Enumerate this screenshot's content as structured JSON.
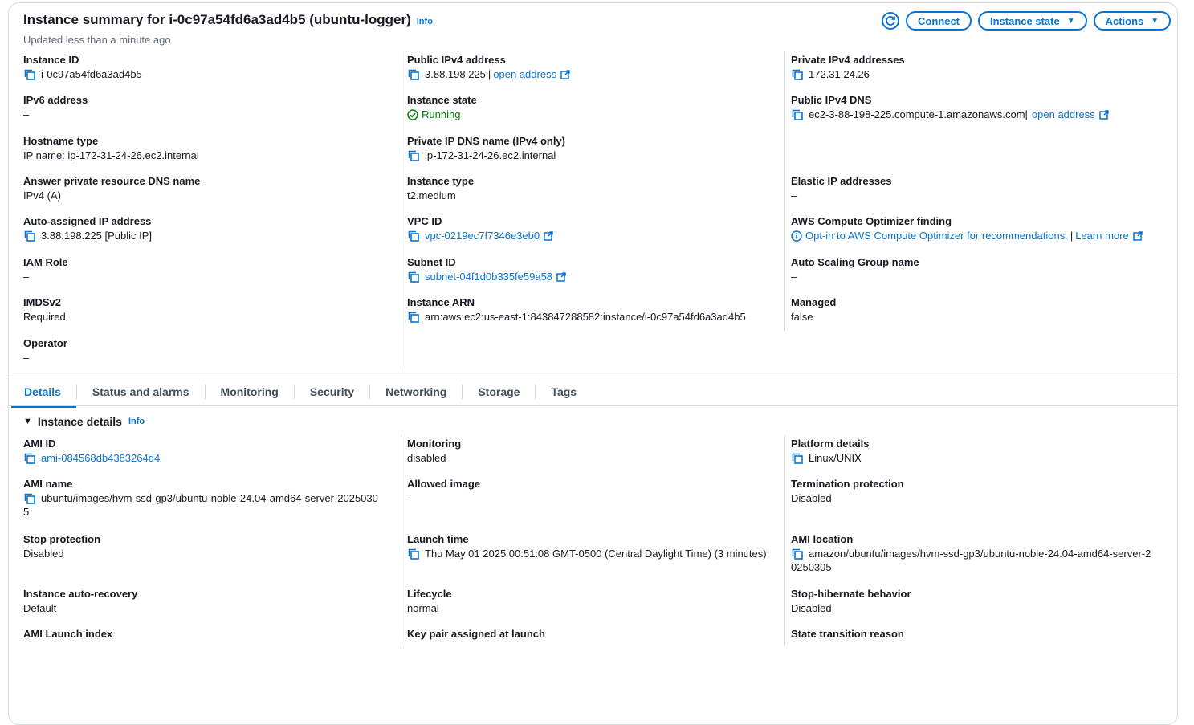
{
  "summary": {
    "title": "Instance summary for i-0c97a54fd6a3ad4b5 (ubuntu-logger)",
    "info": "Info",
    "updated": "Updated less than a minute ago",
    "buttons": {
      "connect": "Connect",
      "instance_state": "Instance state",
      "actions": "Actions"
    },
    "col1": [
      {
        "label": "Instance ID",
        "value": "i-0c97a54fd6a3ad4b5"
      },
      {
        "label": "IPv6 address",
        "value": "–"
      },
      {
        "label": "Hostname type",
        "value": "IP name: ip-172-31-24-26.ec2.internal"
      },
      {
        "label": "Answer private resource DNS name",
        "value": "IPv4 (A)"
      },
      {
        "label": "Auto-assigned IP address",
        "value": "3.88.198.225 [Public IP]"
      },
      {
        "label": "IAM Role",
        "value": "–"
      },
      {
        "label": "IMDSv2",
        "value": "Required"
      },
      {
        "label": "Operator",
        "value": "–"
      }
    ],
    "col2": [
      {
        "label": "Public IPv4 address",
        "value": "3.88.198.225",
        "link": "open address"
      },
      {
        "label": "Instance state",
        "value": "Running"
      },
      {
        "label": "Private IP DNS name (IPv4 only)",
        "value": "ip-172-31-24-26.ec2.internal"
      },
      {
        "label": "Instance type",
        "value": "t2.medium"
      },
      {
        "label": "VPC ID",
        "value": "vpc-0219ec7f7346e3eb0"
      },
      {
        "label": "Subnet ID",
        "value": "subnet-04f1d0b335fe59a58"
      },
      {
        "label": "Instance ARN",
        "value": "arn:aws:ec2:us-east-1:843847288582:instance/i-0c97a54fd6a3ad4b5"
      }
    ],
    "col3": [
      {
        "label": "Private IPv4 addresses",
        "value": "172.31.24.26"
      },
      {
        "label": "Public IPv4 DNS",
        "value": "ec2-3-88-198-225.compute-1.amazonaws.com",
        "link": "open address"
      },
      {
        "label": "Elastic IP addresses",
        "value": "–"
      },
      {
        "label": "AWS Compute Optimizer finding",
        "value": "Opt-in to AWS Compute Optimizer for recommendations.",
        "link": "Learn more"
      },
      {
        "label": "Auto Scaling Group name",
        "value": "–"
      },
      {
        "label": "Managed",
        "value": "false"
      }
    ]
  },
  "tabs": [
    "Details",
    "Status and alarms",
    "Monitoring",
    "Security",
    "Networking",
    "Storage",
    "Tags"
  ],
  "details": {
    "heading": "Instance details",
    "info": "Info",
    "col1": [
      {
        "label": "AMI ID",
        "value": "ami-084568db4383264d4"
      },
      {
        "label": "AMI name",
        "value_line1": "ubuntu/images/hvm-ssd-gp3/ubuntu-noble-24.04-amd64-server-2025030",
        "value_line2": "5"
      },
      {
        "label": "Stop protection",
        "value": "Disabled"
      },
      {
        "label": "Instance auto-recovery",
        "value": "Default"
      },
      {
        "label": "AMI Launch index",
        "value": ""
      }
    ],
    "col2": [
      {
        "label": "Monitoring",
        "value": "disabled"
      },
      {
        "label": "Allowed image",
        "value": "-"
      },
      {
        "label": "Launch time",
        "value": "Thu May 01 2025 00:51:08 GMT-0500 (Central Daylight Time) (3 minutes)"
      },
      {
        "label": "Lifecycle",
        "value": "normal"
      },
      {
        "label": "Key pair assigned at launch",
        "value": ""
      }
    ],
    "col3": [
      {
        "label": "Platform details",
        "value": "Linux/UNIX"
      },
      {
        "label": "Termination protection",
        "value": "Disabled"
      },
      {
        "label": "AMI location",
        "value_line1": "amazon/ubuntu/images/hvm-ssd-gp3/ubuntu-noble-24.04-amd64-server-2",
        "value_line2": "0250305"
      },
      {
        "label": "Stop-hibernate behavior",
        "value": "Disabled"
      },
      {
        "label": "State transition reason",
        "value": ""
      }
    ]
  },
  "colors": {
    "link": "#0972d3",
    "running": "#037f0c",
    "border": "#d5dbdb"
  }
}
